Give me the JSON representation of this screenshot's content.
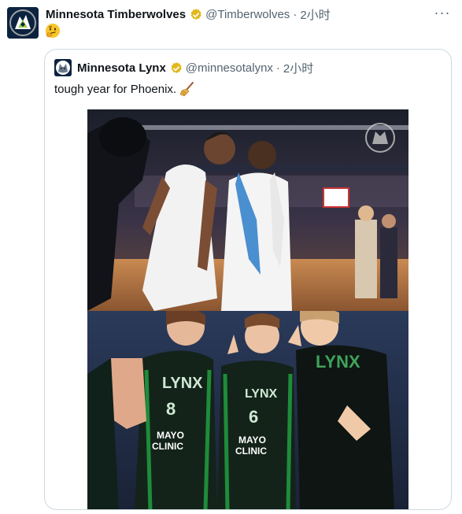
{
  "tweet": {
    "author_name": "Minnesota Timberwolves",
    "handle": "@Timberwolves",
    "separator": "·",
    "time": "2小时",
    "more_label": "···",
    "body_emoji": "thinking-face-emoji",
    "verified_color": "#e2b719"
  },
  "quoted": {
    "author_name": "Minnesota Lynx",
    "handle": "@minnesotalynx",
    "separator": "·",
    "time": "2小时",
    "text": "tough year for Phoenix.",
    "text_emoji": "broom-emoji",
    "photos": [
      {
        "icon": "photo-players-celebrating",
        "jersey_text": [
          "LYNX",
          "8",
          "6",
          "MAYO CLINIC",
          "LYNX"
        ]
      }
    ]
  },
  "colors": {
    "text_primary": "#0f1419",
    "text_secondary": "#536471",
    "border": "#cfd9de",
    "lynx_green": "#1e8c3a",
    "navy": "#0c2340"
  }
}
